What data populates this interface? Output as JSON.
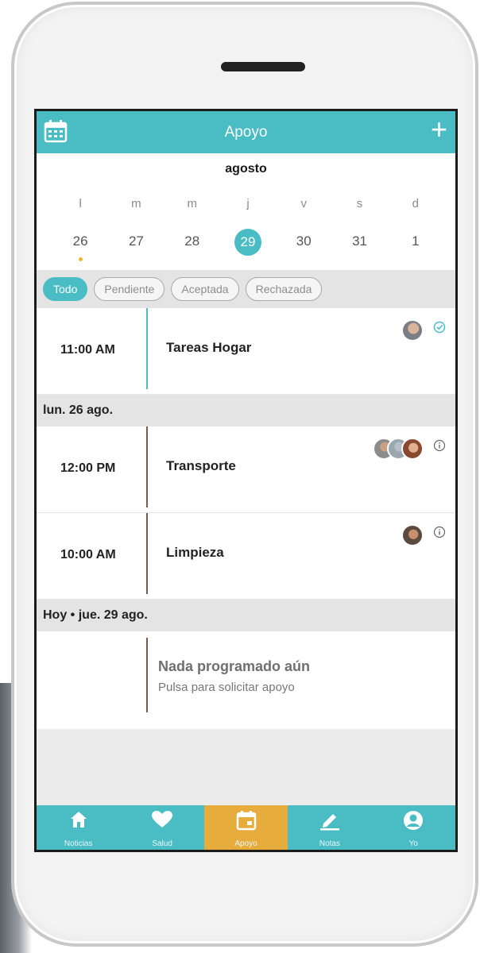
{
  "header": {
    "title": "Apoyo",
    "add_icon": "plus-icon",
    "calendar_icon": "calendar-icon"
  },
  "calendar": {
    "month": "agosto",
    "weekdays": [
      "l",
      "m",
      "m",
      "j",
      "v",
      "s",
      "d"
    ],
    "dates": [
      "26",
      "27",
      "28",
      "29",
      "30",
      "31",
      "1"
    ],
    "selected_index": 3,
    "dot_index": 0
  },
  "filters": [
    "Todo",
    "Pendiente",
    "Aceptada",
    "Rechazada"
  ],
  "events": {
    "first": {
      "time": "11:00 AM",
      "title": "Tareas Hogar",
      "status": "accepted"
    },
    "day1_header": "lun. 26 ago.",
    "second": {
      "time": "12:00 PM",
      "title": "Transporte",
      "status": "info"
    },
    "third": {
      "time": "10:00 AM",
      "title": "Limpieza",
      "status": "info"
    },
    "today_header": "Hoy • jue. 29 ago.",
    "empty_title": "Nada programado aún",
    "empty_sub": "Pulsa para solicitar apoyo"
  },
  "tabbar": [
    {
      "label": "Noticias",
      "icon": "home-icon"
    },
    {
      "label": "Salud",
      "icon": "heart-icon"
    },
    {
      "label": "Apoyo",
      "icon": "calendar-icon"
    },
    {
      "label": "Notas",
      "icon": "pencil-icon"
    },
    {
      "label": "Yo",
      "icon": "user-icon"
    }
  ],
  "colors": {
    "accent": "#49bcc4",
    "active_tab": "#e6ac3c",
    "dot": "#f2b52b"
  }
}
